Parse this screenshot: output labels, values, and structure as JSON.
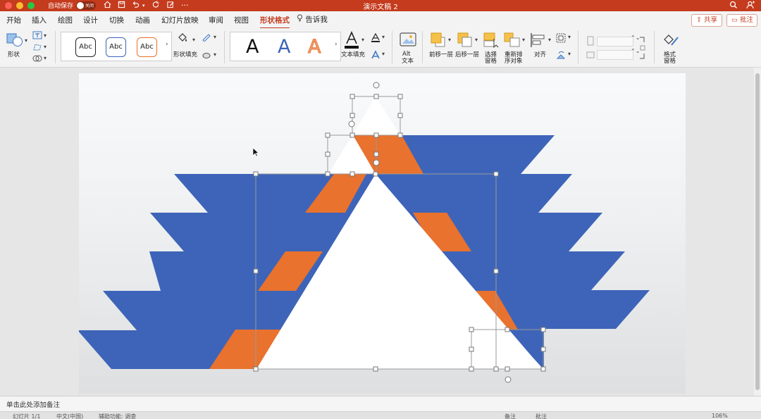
{
  "titlebar": {
    "autosave_label": "自动保存",
    "autosave_state": "关闭",
    "document_title": "演示文稿 2",
    "icons": [
      "home-icon",
      "save-icon",
      "undo-icon",
      "redo-icon",
      "edit-icon",
      "more-icon",
      "search-icon",
      "account-icon"
    ]
  },
  "tabs": [
    {
      "label": "开始",
      "active": false
    },
    {
      "label": "插入",
      "active": false
    },
    {
      "label": "绘图",
      "active": false
    },
    {
      "label": "设计",
      "active": false
    },
    {
      "label": "切换",
      "active": false
    },
    {
      "label": "动画",
      "active": false
    },
    {
      "label": "幻灯片放映",
      "active": false
    },
    {
      "label": "审阅",
      "active": false
    },
    {
      "label": "视图",
      "active": false
    },
    {
      "label": "形状格式",
      "active": true
    }
  ],
  "tell_me": "告诉我",
  "share_label": "共享",
  "comment_label": "批注",
  "ribbon": {
    "shapes_label": "形状",
    "style_sample": "Abc",
    "shape_fill_label": "形状填充",
    "wordart_sample": "A",
    "text_fill_label": "文本填充",
    "alt_text_label_1": "Alt",
    "alt_text_label_2": "文本",
    "bring_forward_label": "前移一层",
    "send_backward_label": "后移一层",
    "selection_pane_label_1": "选择",
    "selection_pane_label_2": "窗格",
    "reorder_label_1": "重新排",
    "reorder_label_2": "序对象",
    "align_label": "对齐",
    "format_pane_label_1": "格式",
    "format_pane_label_2": "窗格"
  },
  "colors": {
    "accent": "#c43b1d",
    "blue_shape": "#3d64b8",
    "orange_shape": "#e8722e",
    "white_shape": "#ffffff"
  },
  "notes_placeholder": "单击此处添加备注",
  "status": {
    "slide_info": "幻灯片 1/1",
    "language": "中文(中国)",
    "accessibility": "辅助功能: 调查",
    "notes_btn": "备注",
    "comments_btn": "批注",
    "zoom": "106%"
  }
}
